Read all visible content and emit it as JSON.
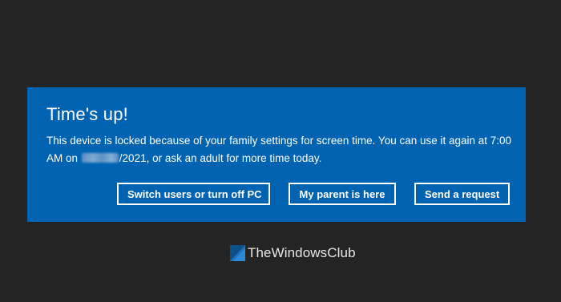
{
  "dialog": {
    "title": "Time's up!",
    "message_part1": "This device is locked because of your family settings for screen time. You can use it again at 7:00 AM on",
    "message_part2": "/2021, or ask an adult for more time today.",
    "background_color": "#0063b1"
  },
  "buttons": {
    "switch_label": "Switch users or turn off PC",
    "parent_label": "My parent is here",
    "request_label": "Send a request"
  },
  "watermark": {
    "text": "TheWindowsClub",
    "logo_icon": "thewindowsclub-logo-icon"
  }
}
